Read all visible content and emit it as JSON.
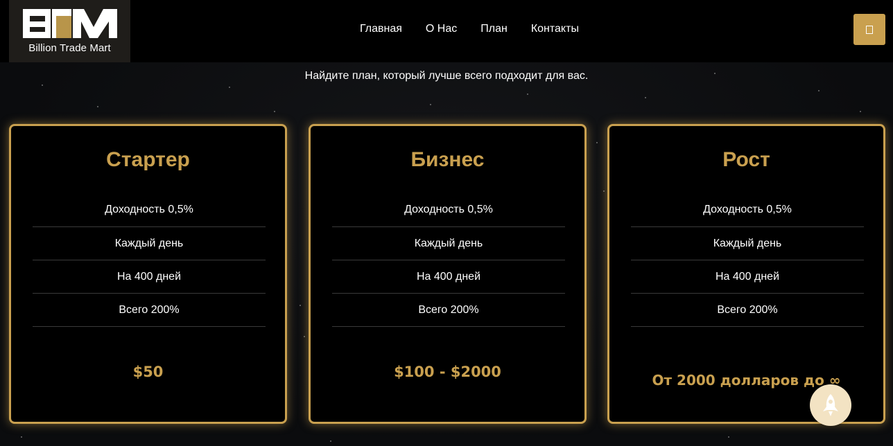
{
  "brand": {
    "name": "Billion Trade Mart",
    "mark": "BTM"
  },
  "nav": {
    "items": [
      "Главная",
      "О Нас",
      "План",
      "Контакты"
    ]
  },
  "subtitle": "Найдите план, который лучше всего подходит для вас.",
  "plans": [
    {
      "title": "Стартер",
      "features": [
        "Доходность 0,5%",
        "Каждый день",
        "На 400 дней",
        "Всего 200%"
      ],
      "price": "$50"
    },
    {
      "title": "Бизнес",
      "features": [
        "Доходность 0,5%",
        "Каждый день",
        "На 400 дней",
        "Всего 200%"
      ],
      "price": "$100 - $2000"
    },
    {
      "title": "Рост",
      "features": [
        "Доходность 0,5%",
        "Каждый день",
        "На 400 дней",
        "Всего 200%"
      ],
      "price": "От 2000 долларов до ∞"
    }
  ],
  "icons": {
    "menu": "menu-icon",
    "scroll_top": "rocket-icon"
  },
  "colors": {
    "accent": "#c9a04f",
    "background": "#0b0c0e",
    "card": "#000000",
    "rocket_bg": "#f3e3c3"
  }
}
